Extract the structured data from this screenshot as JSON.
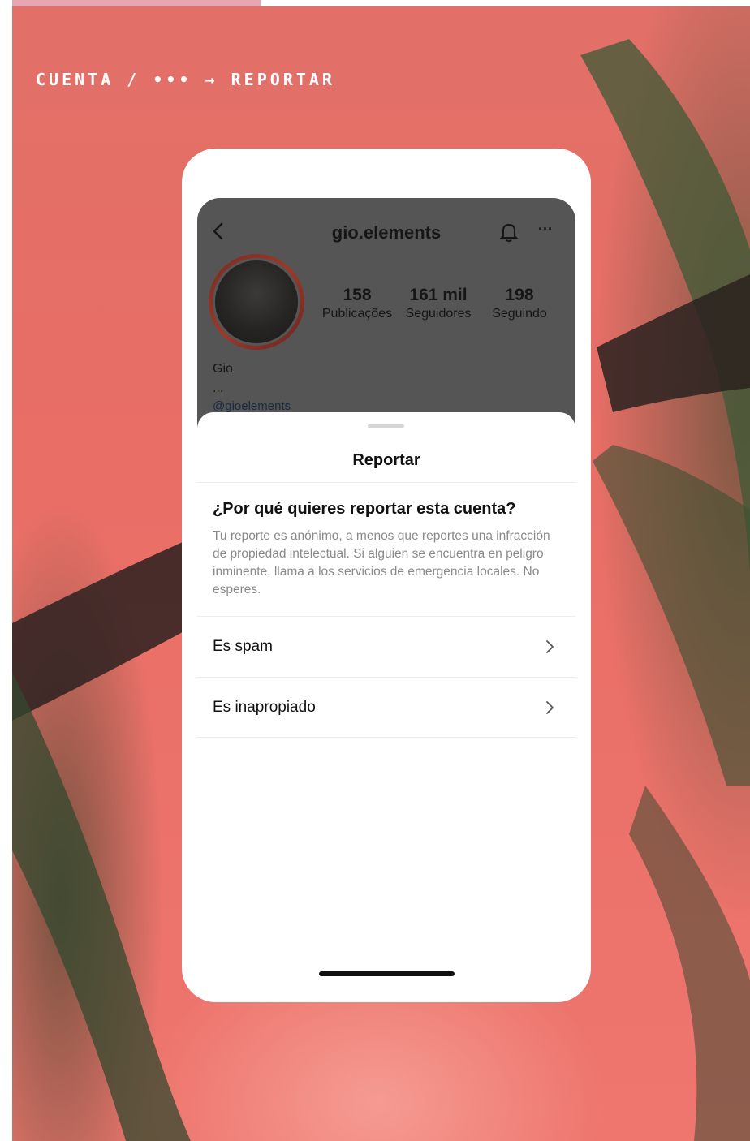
{
  "breadcrumb": "CUENTA / ••• → REPORTAR",
  "profile": {
    "username": "gio.elements",
    "stats": [
      {
        "number": "158",
        "label": "Publicações"
      },
      {
        "number": "161 mil",
        "label": "Seguidores"
      },
      {
        "number": "198",
        "label": "Seguindo"
      }
    ],
    "name": "Gio",
    "bio_dots": "...",
    "handle": "@gioelements"
  },
  "sheet": {
    "title": "Reportar",
    "question": "¿Por qué quieres reportar esta cuenta?",
    "description": "Tu reporte es anónimo, a menos que reportes una infracción de propiedad intelectual. Si alguien se encuentra en peligro inminente, llama a los servicios de emergencia locales. No esperes.",
    "options": [
      {
        "label": "Es spam"
      },
      {
        "label": "Es inapropiado"
      }
    ]
  },
  "colors": {
    "background": "#e8706a",
    "overlay": "#555555",
    "accent_strip": "#e8a5b2"
  },
  "icons": [
    "back-arrow-icon",
    "bell-icon",
    "more-icon",
    "chevron-right-icon"
  ]
}
